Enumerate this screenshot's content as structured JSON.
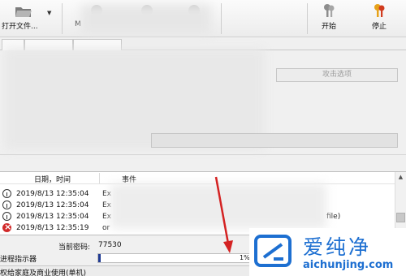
{
  "toolbar": {
    "open_label": "打开文件...",
    "m_label": "M",
    "start_label": "开始",
    "stop_label": "停止"
  },
  "attack_options_label": "攻击选项",
  "log": {
    "headers": {
      "datetime": "日期，时间",
      "event": "事件"
    },
    "rows": [
      {
        "icon": "info-icon",
        "datetime": "2019/8/13 12:35:04",
        "event": "Ex"
      },
      {
        "icon": "info-icon",
        "datetime": "2019/8/13 12:35:04",
        "event": "Ex"
      },
      {
        "icon": "info-icon",
        "datetime": "2019/8/13 12:35:04",
        "event": "Ex"
      },
      {
        "icon": "error-icon",
        "datetime": "2019/8/13 12:35:19",
        "event": "or"
      }
    ],
    "row_tail": "file)"
  },
  "current_password": {
    "label": "当前密码:",
    "value": "77530"
  },
  "progress": {
    "label": "进程指示器",
    "percent_text": "1%",
    "fraction": 0.01
  },
  "status_text": "权给家庭及商业使用(单机)",
  "watermark": {
    "text_cn": "爱纯净",
    "url": "aichunjing.com",
    "color": "#1d6fd1"
  },
  "colors": {
    "arrow": "#d42222",
    "progress_fill": "#1f3a93",
    "error": "#d12a2a"
  }
}
